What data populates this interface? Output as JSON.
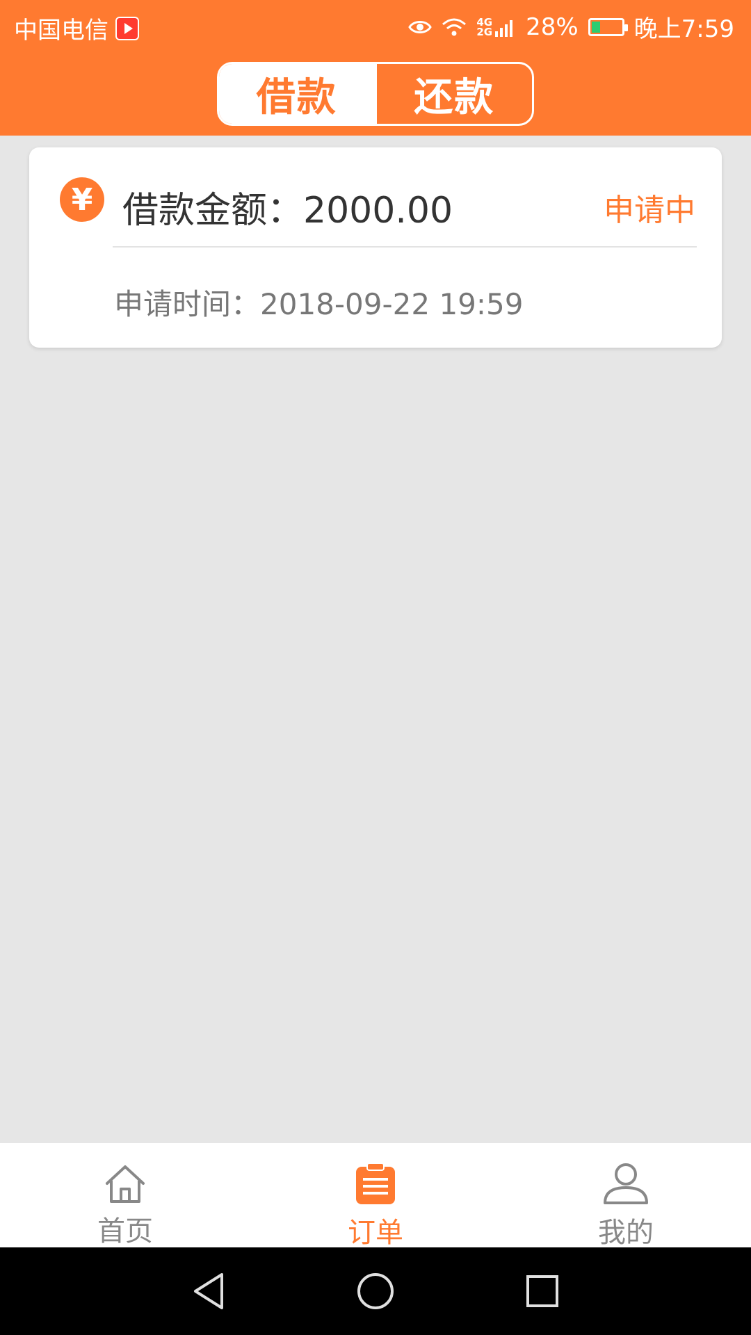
{
  "status_bar": {
    "carrier": "中国电信",
    "network": "4G\n2G",
    "battery_percent": "28%",
    "time": "晚上7:59",
    "battery_level": 0.28
  },
  "tabs": [
    {
      "label": "借款",
      "active": true
    },
    {
      "label": "还款",
      "active": false
    }
  ],
  "order_card": {
    "icon": "yen-icon",
    "amount_label": "借款金额：",
    "amount_value": "2000.00",
    "status": "申请中",
    "apply_time_label": "申请时间：",
    "apply_time_value": "2018-09-22 19:59"
  },
  "bottom_nav": [
    {
      "label": "首页",
      "icon": "home-icon",
      "active": false
    },
    {
      "label": "订单",
      "icon": "clipboard-icon",
      "active": true
    },
    {
      "label": "我的",
      "icon": "user-icon",
      "active": false
    }
  ],
  "system_nav": [
    "back-icon",
    "home-circle-icon",
    "recents-icon"
  ],
  "colors": {
    "accent": "#ff7a30",
    "background": "#e6e6e6",
    "inactive_text": "#888888"
  }
}
